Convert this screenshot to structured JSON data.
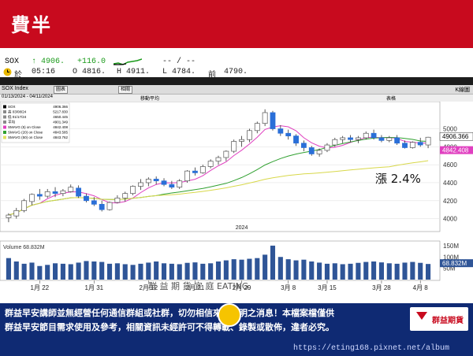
{
  "header": {
    "title": "費半"
  },
  "quote": {
    "symbol": "SOX",
    "arrow": "↑",
    "last": "4906.",
    "change": "+116.0",
    "bid_ask": "-- / --",
    "day_label": "於",
    "time": "05:16",
    "open_label": "O",
    "open": "4816.",
    "high_label": "H",
    "high": "4911.",
    "low_label": "L",
    "low": "4784.",
    "prev_label": "前",
    "prev": "4790."
  },
  "toolbar": {
    "index_name": "SOX Index",
    "menu_1": "圖表",
    "menu_2": "相關",
    "range_label": "01/13/2024 - 04/11/2024",
    "period_label": "移動平均",
    "table_label": "表格",
    "right_label": "K線圖"
  },
  "chart_data": {
    "type": "candlestick",
    "x_ticks": [
      "1月 22",
      "1月 31",
      "2月 12",
      "2月 21",
      "2月 29",
      "3月 8",
      "3月 15",
      "3月 28",
      "4月 8"
    ],
    "year_label": "2024",
    "y_ticks": [
      "5000",
      "4800",
      "4600",
      "4400",
      "4200",
      "4000"
    ],
    "ylim": [
      3900,
      5250
    ],
    "last_price_label": "4906.366",
    "ma_label": "4842.408",
    "annotation": "漲 2.4%",
    "legend": [
      {
        "name": "SOX",
        "value": "4906.366",
        "color": "#000000"
      },
      {
        "name": "高 03/08/24",
        "value": "5217.830",
        "color": "#888888"
      },
      {
        "name": "低 01/17/24",
        "value": "4650.445",
        "color": "#888888"
      },
      {
        "name": "平均",
        "value": "4901.349",
        "color": "#888888"
      },
      {
        "name": "SMAVG (5) on Close",
        "value": "4842.408",
        "color": "#e040c0"
      },
      {
        "name": "SMAVG (20) on Close",
        "value": "4843.585",
        "color": "#30a030"
      },
      {
        "name": "SMAVG (50) on Close",
        "value": "4843.762",
        "color": "#e0e060"
      }
    ],
    "volume_label": "Volume",
    "volume_value": "68.832M",
    "volume_ticks": [
      "150M",
      "100M",
      "50M"
    ],
    "candles": [
      [
        4010,
        4060,
        3960,
        4040
      ],
      [
        4030,
        4120,
        4000,
        4090
      ],
      [
        4090,
        4220,
        4070,
        4200
      ],
      [
        4190,
        4280,
        4150,
        4270
      ],
      [
        4270,
        4330,
        4210,
        4250
      ],
      [
        4250,
        4330,
        4230,
        4300
      ],
      [
        4300,
        4350,
        4240,
        4280
      ],
      [
        4280,
        4330,
        4250,
        4310
      ],
      [
        4300,
        4380,
        4290,
        4350
      ],
      [
        4340,
        4370,
        4230,
        4250
      ],
      [
        4250,
        4280,
        4180,
        4200
      ],
      [
        4200,
        4240,
        4140,
        4160
      ],
      [
        4160,
        4200,
        4080,
        4100
      ],
      [
        4100,
        4190,
        4090,
        4180
      ],
      [
        4180,
        4260,
        4170,
        4230
      ],
      [
        4230,
        4300,
        4190,
        4280
      ],
      [
        4280,
        4370,
        4260,
        4360
      ],
      [
        4360,
        4440,
        4320,
        4400
      ],
      [
        4400,
        4460,
        4360,
        4440
      ],
      [
        4440,
        4470,
        4380,
        4420
      ],
      [
        4420,
        4450,
        4360,
        4380
      ],
      [
        4380,
        4420,
        4330,
        4350
      ],
      [
        4350,
        4440,
        4330,
        4420
      ],
      [
        4420,
        4540,
        4400,
        4530
      ],
      [
        4530,
        4570,
        4480,
        4510
      ],
      [
        4510,
        4600,
        4500,
        4580
      ],
      [
        4580,
        4660,
        4560,
        4640
      ],
      [
        4640,
        4700,
        4600,
        4680
      ],
      [
        4680,
        4760,
        4640,
        4750
      ],
      [
        4750,
        4880,
        4730,
        4860
      ],
      [
        4860,
        4920,
        4800,
        4880
      ],
      [
        4880,
        5000,
        4850,
        4980
      ],
      [
        4980,
        5080,
        4950,
        5060
      ],
      [
        5060,
        5217,
        5030,
        5180
      ],
      [
        5180,
        5200,
        4980,
        5000
      ],
      [
        5000,
        5040,
        4920,
        4950
      ],
      [
        4950,
        4990,
        4880,
        4920
      ],
      [
        4920,
        4940,
        4810,
        4840
      ],
      [
        4840,
        4870,
        4750,
        4790
      ],
      [
        4790,
        4810,
        4700,
        4720
      ],
      [
        4720,
        4780,
        4690,
        4760
      ],
      [
        4760,
        4840,
        4740,
        4820
      ],
      [
        4820,
        4900,
        4800,
        4880
      ],
      [
        4880,
        4920,
        4840,
        4900
      ],
      [
        4900,
        4930,
        4850,
        4880
      ],
      [
        4880,
        4920,
        4840,
        4900
      ],
      [
        4900,
        4970,
        4880,
        4950
      ],
      [
        4950,
        4990,
        4880,
        4900
      ],
      [
        4900,
        4930,
        4850,
        4870
      ],
      [
        4870,
        4920,
        4850,
        4900
      ],
      [
        4900,
        4930,
        4820,
        4840
      ],
      [
        4840,
        4870,
        4780,
        4790
      ],
      [
        4790,
        4860,
        4780,
        4850
      ],
      [
        4850,
        4900,
        4800,
        4820
      ],
      [
        4820,
        4910,
        4784,
        4906
      ]
    ],
    "volumes": [
      95,
      80,
      70,
      75,
      60,
      65,
      72,
      70,
      68,
      75,
      82,
      80,
      78,
      70,
      72,
      68,
      65,
      70,
      75,
      80,
      72,
      70,
      68,
      74,
      76,
      70,
      72,
      80,
      85,
      90,
      88,
      92,
      95,
      110,
      150,
      100,
      90,
      85,
      88,
      80,
      75,
      70,
      72,
      68,
      70,
      74,
      78,
      80,
      76,
      72,
      70,
      75,
      78,
      74,
      69
    ]
  },
  "footer": {
    "line1": "群益早安講師並無經營任何通信群組或社群，切勿相信來源不明之消息！本檔案檔僅供",
    "line2": "群益早安節目需求使用及參考，相關資訊未經許可不得轉載、錄製或散佈，違者必究。",
    "brand": "群益期貨",
    "url": "https://eting168.pixnet.net/album"
  },
  "watermark": {
    "text": "群 益 期 貨     宜 庭 EATING"
  },
  "colors": {
    "header": "#c80a1e",
    "footer": "#0f2a73",
    "up": "#1a9a1a",
    "candle_down": "#2a6fd8"
  }
}
